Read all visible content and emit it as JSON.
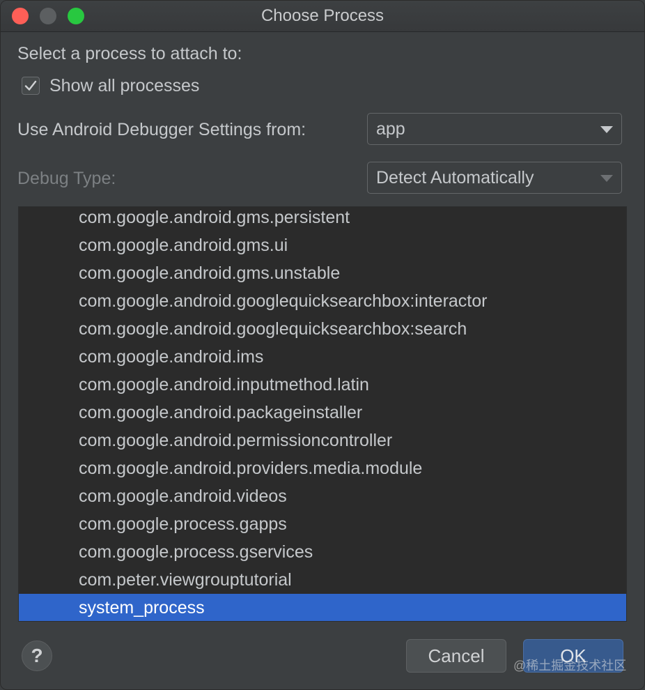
{
  "window": {
    "title": "Choose Process"
  },
  "prompt": "Select a process to attach to:",
  "show_all": {
    "label": "Show all processes",
    "checked": true
  },
  "settings": {
    "label": "Use Android Debugger Settings from:",
    "value": "app"
  },
  "debug_type": {
    "label": "Debug Type:",
    "value": "Detect Automatically"
  },
  "processes": [
    "com.google.android.gms.persistent",
    "com.google.android.gms.ui",
    "com.google.android.gms.unstable",
    "com.google.android.googlequicksearchbox:interactor",
    "com.google.android.googlequicksearchbox:search",
    "com.google.android.ims",
    "com.google.android.inputmethod.latin",
    "com.google.android.packageinstaller",
    "com.google.android.permissioncontroller",
    "com.google.android.providers.media.module",
    "com.google.android.videos",
    "com.google.process.gapps",
    "com.google.process.gservices",
    "com.peter.viewgrouptutorial",
    "system_process"
  ],
  "selected_process": "system_process",
  "buttons": {
    "help": "?",
    "cancel": "Cancel",
    "ok": "OK"
  },
  "watermark": "@稀土掘金技术社区",
  "colors": {
    "selection": "#2f65ca",
    "background": "#3c3f41",
    "list_background": "#2b2b2b"
  }
}
